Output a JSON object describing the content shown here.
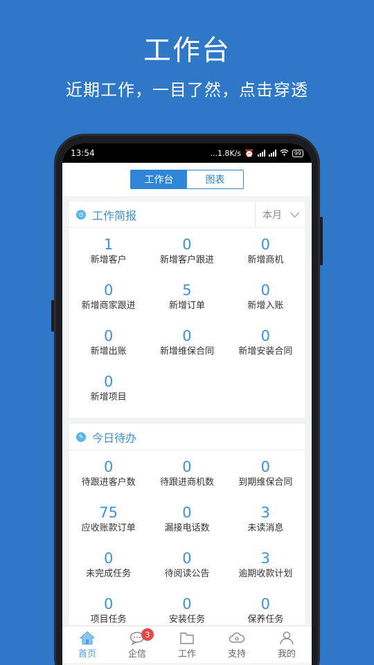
{
  "promo": {
    "title": "工作台",
    "subtitle": "近期工作，一目了然，点击穿透"
  },
  "status_bar": {
    "time": "13:54",
    "network_speed": "...1.8K/s",
    "battery": "99"
  },
  "top_tabs": {
    "workbench": "工作台",
    "chart": "图表"
  },
  "report": {
    "title": "工作简报",
    "period": "本月",
    "items": [
      {
        "value": "1",
        "label": "新增客户"
      },
      {
        "value": "0",
        "label": "新增客户跟进"
      },
      {
        "value": "0",
        "label": "新增商机"
      },
      {
        "value": "0",
        "label": "新增商家跟进"
      },
      {
        "value": "5",
        "label": "新增订单"
      },
      {
        "value": "0",
        "label": "新增入账"
      },
      {
        "value": "0",
        "label": "新增出账"
      },
      {
        "value": "0",
        "label": "新增维保合同"
      },
      {
        "value": "0",
        "label": "新增安装合同"
      },
      {
        "value": "0",
        "label": "新增项目"
      }
    ]
  },
  "todo": {
    "title": "今日待办",
    "items": [
      {
        "value": "0",
        "label": "待跟进客户数"
      },
      {
        "value": "0",
        "label": "待跟进商机数"
      },
      {
        "value": "0",
        "label": "到期维保合同"
      },
      {
        "value": "75",
        "label": "应收账款订单"
      },
      {
        "value": "0",
        "label": "漏接电话数"
      },
      {
        "value": "3",
        "label": "未读消息"
      },
      {
        "value": "0",
        "label": "未完成任务"
      },
      {
        "value": "0",
        "label": "待阅读公告"
      },
      {
        "value": "3",
        "label": "逾期收款计划"
      },
      {
        "value": "0",
        "label": "项目任务"
      },
      {
        "value": "0",
        "label": "安装任务"
      },
      {
        "value": "0",
        "label": "保养任务"
      }
    ]
  },
  "bottom_nav": {
    "home": "首页",
    "messages": "企信",
    "messages_badge": "3",
    "work": "工作",
    "support": "支持",
    "mine": "我的"
  },
  "colors": {
    "background": "#2f78c8",
    "accent": "#2f86d6",
    "number": "#3a93db",
    "badge": "#e24a4a"
  }
}
